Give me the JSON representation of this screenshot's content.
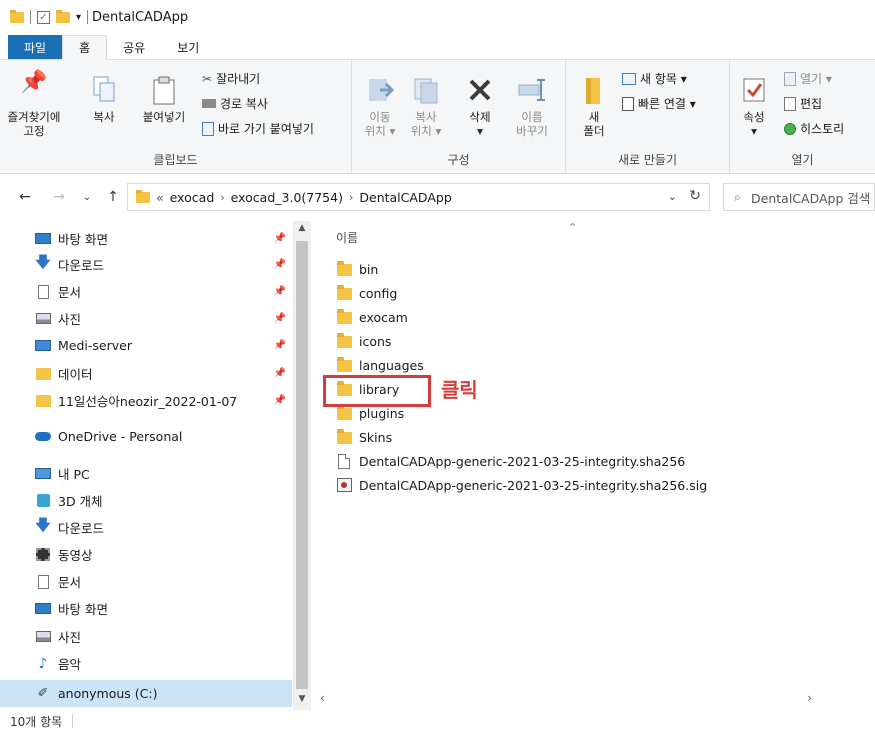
{
  "window": {
    "title": "DentalCADApp"
  },
  "ribbon_tabs": [
    "파일",
    "홈",
    "공유",
    "보기"
  ],
  "ribbon": {
    "clipboard": {
      "label": "클립보드",
      "pin": "즐겨찾기에\n고정",
      "copy": "복사",
      "paste": "붙여넣기",
      "cut": "잘라내기",
      "copy_path": "경로 복사",
      "paste_shortcut": "바로 가기 붙여넣기"
    },
    "organize": {
      "label": "구성",
      "move_to": "이동\n위치 ▾",
      "copy_to": "복사\n위치 ▾",
      "delete": "삭제\n▾",
      "rename": "이름\n바꾸기"
    },
    "new": {
      "label": "새로 만들기",
      "new_folder": "새\n폴더",
      "new_item": "새 항목 ▾",
      "easy_access": "빠른 연결 ▾"
    },
    "open": {
      "label": "열기",
      "properties": "속성\n▾",
      "open": "열기 ▾",
      "edit": "편집",
      "history": "히스토리"
    }
  },
  "address": {
    "overflow": "«",
    "crumbs": [
      "exocad",
      "exocad_3.0(7754)",
      "DentalCADApp"
    ],
    "search_placeholder": "DentalCADApp 검색"
  },
  "nav_items": [
    {
      "label": "바탕 화면",
      "icon": "desktop-icon",
      "pinned": true
    },
    {
      "label": "다운로드",
      "icon": "download-icon",
      "pinned": true
    },
    {
      "label": "문서",
      "icon": "document-icon",
      "pinned": true
    },
    {
      "label": "사진",
      "icon": "picture-icon",
      "pinned": true
    },
    {
      "label": "Medi-server",
      "icon": "monitor-icon",
      "pinned": true
    },
    {
      "label": "데이터",
      "icon": "folder-icon",
      "pinned": true
    },
    {
      "label": "11일선승아neozir_2022-01-07",
      "icon": "folder-icon",
      "pinned": true
    },
    {
      "label": "OneDrive - Personal",
      "icon": "cloud-icon",
      "pinned": false
    },
    {
      "label": "내 PC",
      "icon": "pc-icon",
      "pinned": false
    },
    {
      "label": "3D 개체",
      "icon": "cube-icon",
      "pinned": false
    },
    {
      "label": "다운로드",
      "icon": "download-icon",
      "pinned": false
    },
    {
      "label": "동영상",
      "icon": "video-icon",
      "pinned": false
    },
    {
      "label": "문서",
      "icon": "document-icon",
      "pinned": false
    },
    {
      "label": "바탕 화면",
      "icon": "desktop-icon",
      "pinned": false
    },
    {
      "label": "사진",
      "icon": "picture-icon",
      "pinned": false
    },
    {
      "label": "음악",
      "icon": "music-icon",
      "pinned": false
    },
    {
      "label": "anonymous (C:)",
      "icon": "drive-icon",
      "pinned": false
    }
  ],
  "file_list": {
    "column_name": "이름",
    "files": [
      {
        "name": "bin",
        "type": "folder"
      },
      {
        "name": "config",
        "type": "folder"
      },
      {
        "name": "exocam",
        "type": "folder"
      },
      {
        "name": "icons",
        "type": "folder"
      },
      {
        "name": "languages",
        "type": "folder"
      },
      {
        "name": "library",
        "type": "folder"
      },
      {
        "name": "plugins",
        "type": "folder"
      },
      {
        "name": "Skins",
        "type": "folder"
      },
      {
        "name": "DentalCADApp-generic-2021-03-25-integrity.sha256",
        "type": "file"
      },
      {
        "name": "DentalCADApp-generic-2021-03-25-integrity.sha256.sig",
        "type": "sig"
      }
    ]
  },
  "annotation": {
    "text": "클릭",
    "color": "#d53c3c"
  },
  "status": {
    "item_count": "10개 항목"
  },
  "colors": {
    "file_tab": "#1a6fb5",
    "folder": "#f4c447",
    "selection": "#cce4f7"
  }
}
